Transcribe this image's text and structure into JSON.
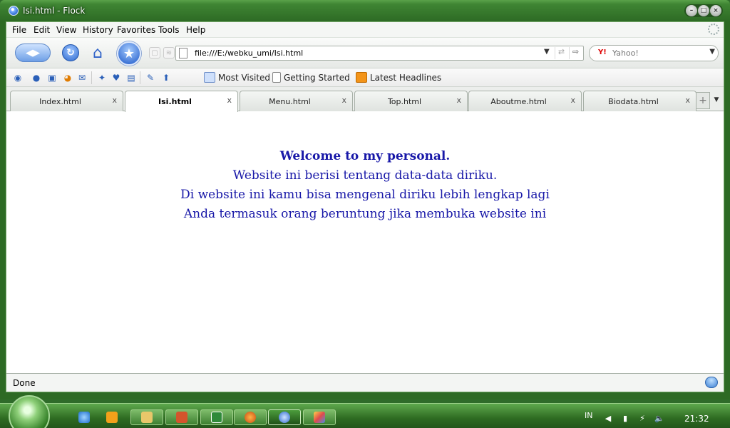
{
  "window": {
    "title": "Isi.html - Flock"
  },
  "menu": {
    "items": [
      {
        "label": "File"
      },
      {
        "label": "Edit"
      },
      {
        "label": "View"
      },
      {
        "label": "History"
      },
      {
        "label": "Favorites"
      },
      {
        "label": "Tools"
      },
      {
        "label": "Help"
      }
    ]
  },
  "navbar": {
    "url": "file:///E:/webku_umi/Isi.html",
    "search_placeholder": "Yahoo!"
  },
  "bookmarks": {
    "items": [
      {
        "label": "Most Visited",
        "icon": "search-bookmark-icon"
      },
      {
        "label": "Getting Started",
        "icon": "page-icon"
      },
      {
        "label": "Latest Headlines",
        "icon": "rss-icon"
      }
    ]
  },
  "tabs": {
    "items": [
      {
        "label": "Index.html",
        "active": false
      },
      {
        "label": "Isi.html",
        "active": true
      },
      {
        "label": "Menu.html",
        "active": false
      },
      {
        "label": "Top.html",
        "active": false
      },
      {
        "label": "Aboutme.html",
        "active": false
      },
      {
        "label": "Biodata.html",
        "active": false
      }
    ],
    "close_glyph": "x"
  },
  "content": {
    "welcome": "Welcome to my personal.",
    "lines": [
      "Website ini berisi tentang data-data diriku.",
      "Di website ini kamu bisa mengenal diriku lebih lengkap lagi",
      "Anda termasuk orang beruntung jika membuka website ini"
    ],
    "text_color": "#1818a8"
  },
  "status": {
    "text": "Done"
  },
  "taskbar": {
    "language": "IN",
    "time": "21:32",
    "apps": [
      {
        "name": "internet-explorer-icon"
      },
      {
        "name": "media-player-icon"
      },
      {
        "name": "file-explorer-icon"
      },
      {
        "name": "powerpoint-icon"
      },
      {
        "name": "excel-icon"
      },
      {
        "name": "firefox-icon"
      },
      {
        "name": "flock-icon"
      },
      {
        "name": "paint-icon"
      }
    ]
  },
  "colors": {
    "frame_green": "#3f8533",
    "accent_blue": "#2d69cf"
  }
}
